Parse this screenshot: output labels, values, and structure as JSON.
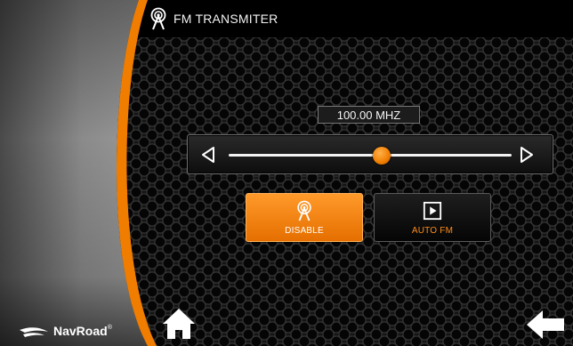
{
  "header": {
    "title": "FM TRANSMITER",
    "icon": "radio-antenna-icon"
  },
  "brand": {
    "name": "NavRoad",
    "mark": "®",
    "logo_icon": "navroad-logo-icon"
  },
  "frequency": {
    "display": "100.00 MHZ",
    "slider_position": 0.54,
    "decrease_icon": "triangle-left-icon",
    "increase_icon": "triangle-right-icon"
  },
  "buttons": {
    "disable": {
      "label": "DISABLE",
      "icon": "radio-antenna-icon",
      "active": true
    },
    "auto_fm": {
      "label": "AUTO FM",
      "icon": "play-icon",
      "active": false
    }
  },
  "navigation": {
    "home_icon": "home-icon",
    "back_icon": "back-arrow-icon"
  },
  "colors": {
    "accent": "#f07d00",
    "accent_light": "#ffa53d",
    "background": "#141414",
    "text": "#ffffff"
  }
}
